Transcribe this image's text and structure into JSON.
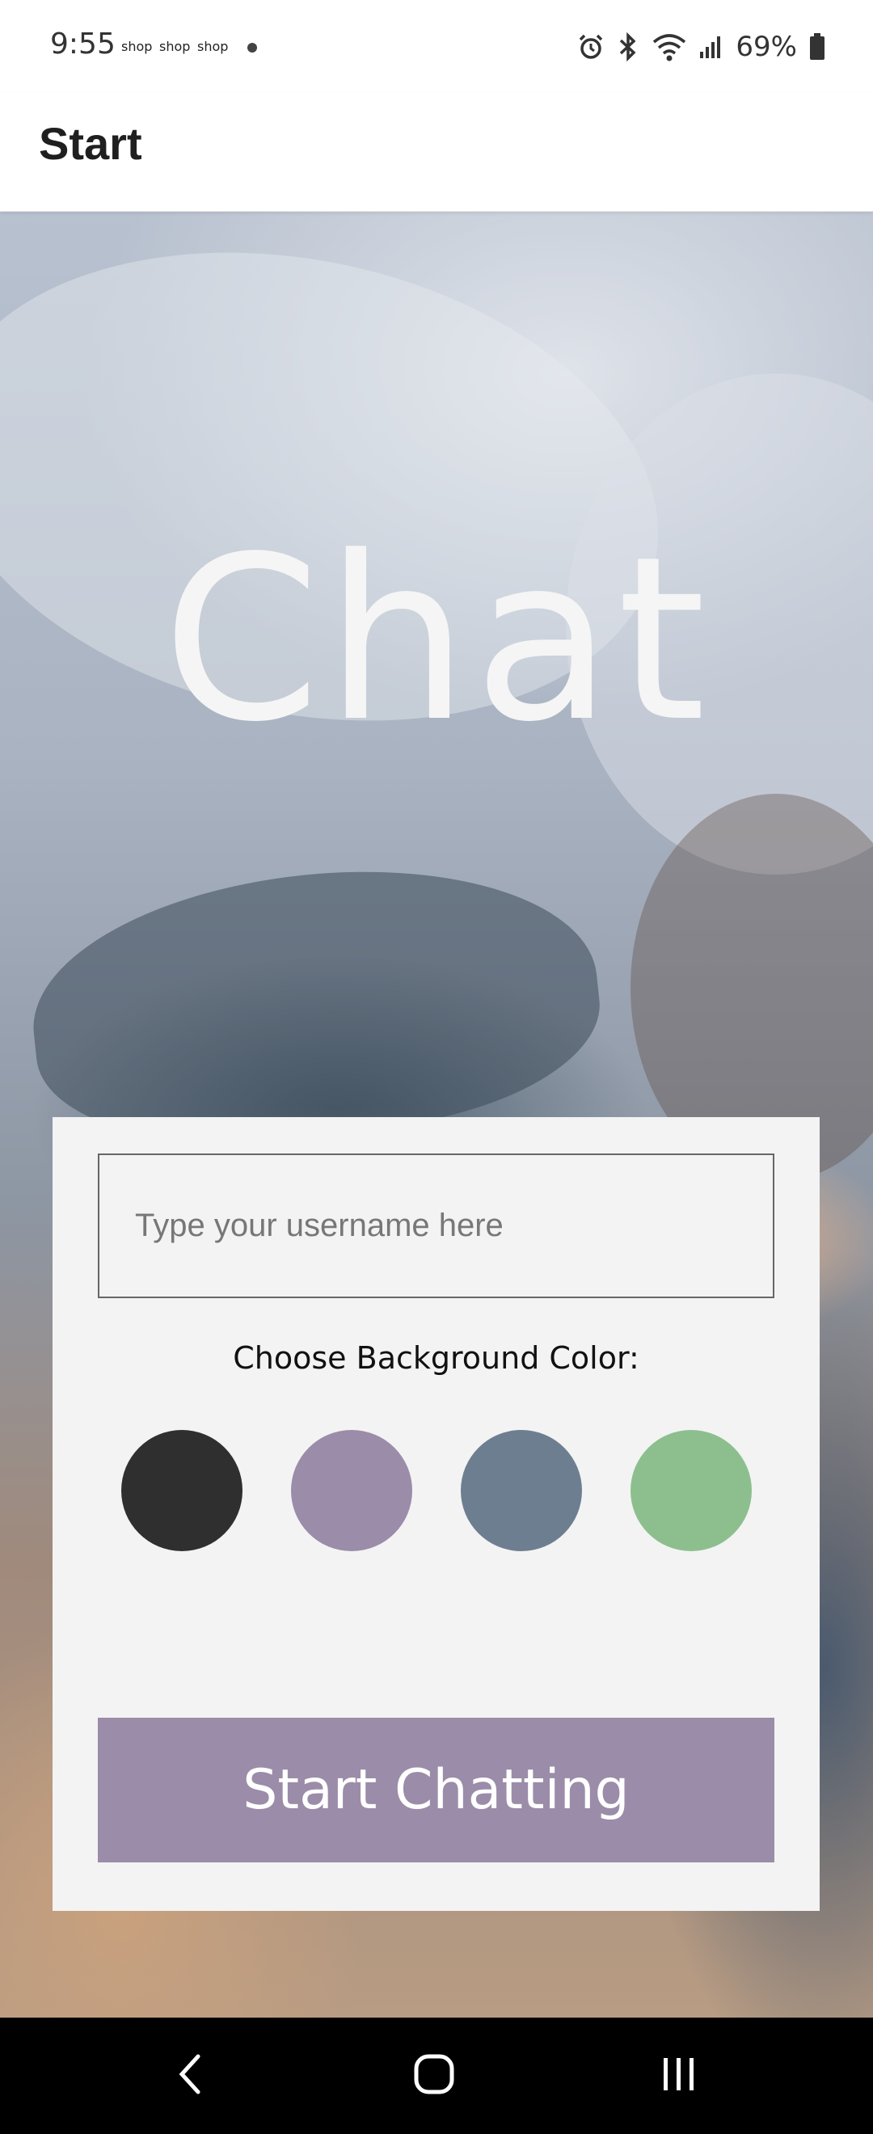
{
  "status_bar": {
    "time": "9:55",
    "notifications": [
      "shop",
      "shop",
      "shop"
    ],
    "battery": "69%",
    "icons": [
      "alarm-icon",
      "bluetooth-icon",
      "wifi-icon",
      "signal-icon",
      "battery-icon"
    ]
  },
  "app_bar": {
    "title": "Start"
  },
  "hero": {
    "title": "Chat"
  },
  "card": {
    "username_placeholder": "Type your username here",
    "username_value": "",
    "color_label": "Choose Background Color:",
    "colors": [
      "#2f2f2f",
      "#9b8ca9",
      "#6e7e91",
      "#8dbf8e"
    ],
    "start_button_label": "Start Chatting",
    "start_button_color": "#9b8ca9"
  },
  "nav_bar": {
    "buttons": [
      "back-icon",
      "home-icon",
      "recents-icon"
    ]
  }
}
